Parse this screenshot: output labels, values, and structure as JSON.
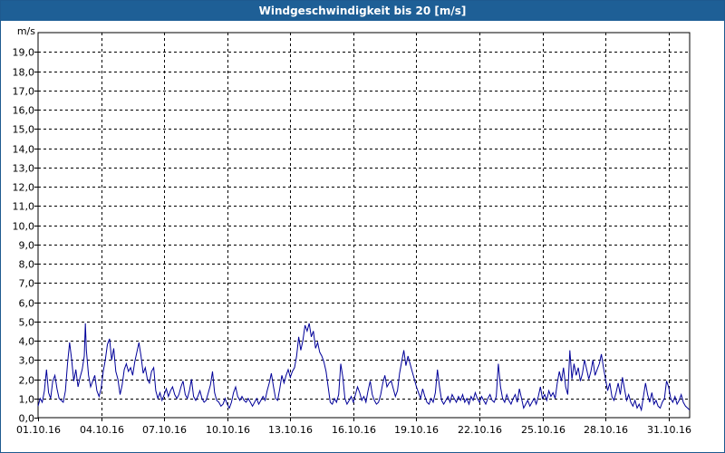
{
  "window": {
    "title": "Windgeschwindigkeit bis 20 [m/s]"
  },
  "colors": {
    "titlebar": "#1e5f96",
    "series": "#000099",
    "grid": "#000000"
  },
  "chart_data": {
    "type": "line",
    "title": "Windgeschwindigkeit bis 20 [m/s]",
    "ylabel": "m/s",
    "xlabel": "",
    "ylim": [
      0,
      20
    ],
    "xlim_days": [
      0,
      31
    ],
    "grid": true,
    "legend": "none",
    "y_ticks": [
      "0,0",
      "1,0",
      "2,0",
      "3,0",
      "4,0",
      "5,0",
      "6,0",
      "7,0",
      "8,0",
      "9,0",
      "10,0",
      "11,0",
      "12,0",
      "13,0",
      "14,0",
      "15,0",
      "16,0",
      "17,0",
      "18,0",
      "19,0"
    ],
    "x_ticks": [
      {
        "label": "01.10.16",
        "day": 0
      },
      {
        "label": "04.10.16",
        "day": 3
      },
      {
        "label": "07.10.16",
        "day": 6
      },
      {
        "label": "10.10.16",
        "day": 9
      },
      {
        "label": "13.10.16",
        "day": 12
      },
      {
        "label": "16.10.16",
        "day": 15
      },
      {
        "label": "19.10.16",
        "day": 18
      },
      {
        "label": "22.10.16",
        "day": 21
      },
      {
        "label": "25.10.16",
        "day": 24
      },
      {
        "label": "28.10.16",
        "day": 27
      },
      {
        "label": "31.10.16",
        "day": 30
      }
    ],
    "series": [
      {
        "values": [
          [
            0.0,
            0.6
          ],
          [
            0.1,
            1.0
          ],
          [
            0.2,
            0.8
          ],
          [
            0.3,
            1.4
          ],
          [
            0.4,
            2.5
          ],
          [
            0.5,
            1.3
          ],
          [
            0.6,
            1.0
          ],
          [
            0.7,
            1.9
          ],
          [
            0.8,
            2.2
          ],
          [
            0.9,
            1.5
          ],
          [
            1.0,
            1.0
          ],
          [
            1.1,
            0.9
          ],
          [
            1.2,
            0.8
          ],
          [
            1.3,
            1.4
          ],
          [
            1.4,
            2.8
          ],
          [
            1.5,
            3.9
          ],
          [
            1.6,
            3.0
          ],
          [
            1.7,
            1.9
          ],
          [
            1.8,
            2.5
          ],
          [
            1.9,
            1.6
          ],
          [
            2.0,
            2.1
          ],
          [
            2.1,
            2.5
          ],
          [
            2.2,
            3.2
          ],
          [
            2.25,
            4.9
          ],
          [
            2.3,
            3.5
          ],
          [
            2.4,
            2.2
          ],
          [
            2.5,
            1.6
          ],
          [
            2.6,
            1.9
          ],
          [
            2.7,
            2.2
          ],
          [
            2.8,
            1.4
          ],
          [
            2.9,
            1.1
          ],
          [
            3.0,
            1.5
          ],
          [
            3.1,
            2.4
          ],
          [
            3.2,
            3.0
          ],
          [
            3.3,
            3.8
          ],
          [
            3.4,
            4.1
          ],
          [
            3.5,
            3.0
          ],
          [
            3.6,
            3.6
          ],
          [
            3.7,
            2.4
          ],
          [
            3.8,
            2.0
          ],
          [
            3.9,
            1.2
          ],
          [
            4.0,
            1.7
          ],
          [
            4.1,
            2.5
          ],
          [
            4.2,
            2.8
          ],
          [
            4.3,
            2.4
          ],
          [
            4.4,
            2.6
          ],
          [
            4.5,
            2.2
          ],
          [
            4.6,
            2.9
          ],
          [
            4.7,
            3.4
          ],
          [
            4.8,
            3.9
          ],
          [
            4.9,
            3.2
          ],
          [
            5.0,
            2.3
          ],
          [
            5.1,
            2.6
          ],
          [
            5.2,
            2.0
          ],
          [
            5.3,
            1.8
          ],
          [
            5.4,
            2.4
          ],
          [
            5.5,
            2.6
          ],
          [
            5.6,
            1.4
          ],
          [
            5.7,
            1.0
          ],
          [
            5.8,
            1.3
          ],
          [
            5.9,
            0.9
          ],
          [
            6.0,
            1.2
          ],
          [
            6.1,
            1.5
          ],
          [
            6.2,
            1.1
          ],
          [
            6.3,
            1.4
          ],
          [
            6.4,
            1.6
          ],
          [
            6.5,
            1.2
          ],
          [
            6.6,
            1.0
          ],
          [
            6.7,
            1.2
          ],
          [
            6.8,
            1.6
          ],
          [
            6.9,
            1.9
          ],
          [
            7.0,
            1.2
          ],
          [
            7.1,
            1.0
          ],
          [
            7.2,
            1.4
          ],
          [
            7.3,
            2.0
          ],
          [
            7.4,
            1.1
          ],
          [
            7.5,
            0.9
          ],
          [
            7.6,
            1.1
          ],
          [
            7.7,
            1.4
          ],
          [
            7.8,
            1.0
          ],
          [
            7.9,
            0.8
          ],
          [
            8.0,
            0.9
          ],
          [
            8.1,
            1.3
          ],
          [
            8.2,
            1.7
          ],
          [
            8.3,
            2.4
          ],
          [
            8.4,
            1.3
          ],
          [
            8.5,
            0.9
          ],
          [
            8.6,
            0.8
          ],
          [
            8.7,
            0.6
          ],
          [
            8.8,
            0.7
          ],
          [
            8.9,
            1.0
          ],
          [
            9.0,
            0.7
          ],
          [
            9.1,
            0.5
          ],
          [
            9.2,
            0.8
          ],
          [
            9.3,
            1.3
          ],
          [
            9.4,
            1.6
          ],
          [
            9.5,
            1.1
          ],
          [
            9.6,
            0.9
          ],
          [
            9.7,
            1.1
          ],
          [
            9.8,
            0.9
          ],
          [
            9.9,
            0.8
          ],
          [
            10.0,
            1.0
          ],
          [
            10.1,
            0.8
          ],
          [
            10.2,
            0.6
          ],
          [
            10.3,
            0.8
          ],
          [
            10.4,
            1.0
          ],
          [
            10.5,
            0.7
          ],
          [
            10.6,
            0.9
          ],
          [
            10.7,
            1.1
          ],
          [
            10.8,
            0.9
          ],
          [
            10.9,
            1.4
          ],
          [
            11.0,
            1.8
          ],
          [
            11.1,
            2.3
          ],
          [
            11.2,
            1.6
          ],
          [
            11.3,
            1.0
          ],
          [
            11.4,
            0.9
          ],
          [
            11.5,
            1.5
          ],
          [
            11.6,
            2.2
          ],
          [
            11.7,
            1.8
          ],
          [
            11.8,
            2.2
          ],
          [
            11.9,
            2.5
          ],
          [
            12.0,
            2.1
          ],
          [
            12.1,
            2.4
          ],
          [
            12.2,
            2.6
          ],
          [
            12.3,
            3.2
          ],
          [
            12.4,
            4.2
          ],
          [
            12.5,
            3.5
          ],
          [
            12.6,
            4.0
          ],
          [
            12.7,
            4.8
          ],
          [
            12.8,
            4.5
          ],
          [
            12.9,
            4.9
          ],
          [
            13.0,
            4.2
          ],
          [
            13.1,
            4.5
          ],
          [
            13.2,
            3.6
          ],
          [
            13.3,
            3.9
          ],
          [
            13.4,
            3.4
          ],
          [
            13.5,
            3.2
          ],
          [
            13.6,
            2.9
          ],
          [
            13.7,
            2.4
          ],
          [
            13.8,
            1.6
          ],
          [
            13.9,
            0.8
          ],
          [
            14.0,
            0.7
          ],
          [
            14.1,
            1.0
          ],
          [
            14.2,
            0.8
          ],
          [
            14.3,
            1.2
          ],
          [
            14.4,
            2.8
          ],
          [
            14.5,
            2.1
          ],
          [
            14.6,
            1.0
          ],
          [
            14.7,
            0.7
          ],
          [
            14.8,
            0.9
          ],
          [
            14.9,
            1.1
          ],
          [
            15.0,
            0.8
          ],
          [
            15.1,
            1.2
          ],
          [
            15.2,
            1.6
          ],
          [
            15.3,
            1.3
          ],
          [
            15.4,
            0.9
          ],
          [
            15.5,
            1.1
          ],
          [
            15.6,
            0.8
          ],
          [
            15.7,
            1.4
          ],
          [
            15.8,
            1.9
          ],
          [
            15.9,
            1.2
          ],
          [
            16.0,
            0.9
          ],
          [
            16.1,
            0.7
          ],
          [
            16.2,
            0.8
          ],
          [
            16.3,
            1.2
          ],
          [
            16.4,
            1.8
          ],
          [
            16.5,
            2.2
          ],
          [
            16.6,
            1.6
          ],
          [
            16.7,
            1.8
          ],
          [
            16.8,
            1.9
          ],
          [
            16.9,
            1.5
          ],
          [
            17.0,
            1.1
          ],
          [
            17.1,
            1.4
          ],
          [
            17.2,
            2.3
          ],
          [
            17.3,
            2.9
          ],
          [
            17.4,
            3.5
          ],
          [
            17.5,
            2.7
          ],
          [
            17.6,
            3.2
          ],
          [
            17.7,
            2.8
          ],
          [
            17.8,
            2.4
          ],
          [
            17.9,
            2.0
          ],
          [
            18.0,
            1.6
          ],
          [
            18.1,
            1.3
          ],
          [
            18.2,
            1.0
          ],
          [
            18.3,
            1.5
          ],
          [
            18.4,
            1.1
          ],
          [
            18.5,
            0.8
          ],
          [
            18.6,
            0.7
          ],
          [
            18.7,
            1.0
          ],
          [
            18.8,
            0.8
          ],
          [
            18.9,
            1.3
          ],
          [
            19.0,
            2.5
          ],
          [
            19.1,
            1.6
          ],
          [
            19.2,
            0.9
          ],
          [
            19.3,
            0.7
          ],
          [
            19.4,
            0.9
          ],
          [
            19.5,
            1.1
          ],
          [
            19.6,
            0.8
          ],
          [
            19.7,
            1.2
          ],
          [
            19.8,
            1.0
          ],
          [
            19.9,
            0.8
          ],
          [
            20.0,
            1.1
          ],
          [
            20.1,
            0.9
          ],
          [
            20.2,
            1.2
          ],
          [
            20.3,
            0.8
          ],
          [
            20.4,
            1.0
          ],
          [
            20.5,
            0.7
          ],
          [
            20.6,
            1.1
          ],
          [
            20.7,
            0.9
          ],
          [
            20.8,
            1.3
          ],
          [
            20.9,
            1.0
          ],
          [
            21.0,
            0.8
          ],
          [
            21.1,
            1.1
          ],
          [
            21.2,
            0.9
          ],
          [
            21.3,
            0.7
          ],
          [
            21.4,
            1.0
          ],
          [
            21.5,
            1.2
          ],
          [
            21.6,
            0.9
          ],
          [
            21.7,
            0.8
          ],
          [
            21.8,
            1.1
          ],
          [
            21.9,
            2.8
          ],
          [
            22.0,
            1.6
          ],
          [
            22.1,
            1.0
          ],
          [
            22.2,
            0.8
          ],
          [
            22.3,
            1.2
          ],
          [
            22.4,
            0.9
          ],
          [
            22.5,
            0.7
          ],
          [
            22.6,
            1.0
          ],
          [
            22.7,
            1.2
          ],
          [
            22.8,
            0.8
          ],
          [
            22.9,
            1.5
          ],
          [
            23.0,
            1.0
          ],
          [
            23.1,
            0.5
          ],
          [
            23.2,
            0.7
          ],
          [
            23.3,
            0.9
          ],
          [
            23.4,
            0.6
          ],
          [
            23.5,
            0.8
          ],
          [
            23.6,
            1.0
          ],
          [
            23.7,
            0.7
          ],
          [
            23.8,
            1.1
          ],
          [
            23.9,
            1.6
          ],
          [
            24.0,
            1.0
          ],
          [
            24.1,
            1.2
          ],
          [
            24.2,
            0.9
          ],
          [
            24.3,
            1.4
          ],
          [
            24.4,
            1.1
          ],
          [
            24.5,
            1.3
          ],
          [
            24.6,
            1.0
          ],
          [
            24.7,
            1.8
          ],
          [
            24.8,
            2.4
          ],
          [
            24.9,
            1.9
          ],
          [
            25.0,
            2.6
          ],
          [
            25.1,
            1.6
          ],
          [
            25.2,
            1.2
          ],
          [
            25.3,
            3.5
          ],
          [
            25.4,
            2.0
          ],
          [
            25.5,
            2.8
          ],
          [
            25.6,
            2.2
          ],
          [
            25.7,
            2.6
          ],
          [
            25.8,
            1.9
          ],
          [
            25.9,
            2.3
          ],
          [
            26.0,
            3.0
          ],
          [
            26.1,
            2.5
          ],
          [
            26.2,
            2.0
          ],
          [
            26.3,
            2.4
          ],
          [
            26.4,
            3.0
          ],
          [
            26.5,
            2.2
          ],
          [
            26.6,
            2.5
          ],
          [
            26.7,
            2.8
          ],
          [
            26.8,
            3.3
          ],
          [
            26.9,
            2.6
          ],
          [
            27.0,
            2.0
          ],
          [
            27.1,
            1.4
          ],
          [
            27.2,
            1.8
          ],
          [
            27.3,
            1.1
          ],
          [
            27.4,
            0.9
          ],
          [
            27.5,
            1.3
          ],
          [
            27.6,
            1.8
          ],
          [
            27.7,
            1.2
          ],
          [
            27.8,
            2.1
          ],
          [
            27.9,
            1.5
          ],
          [
            28.0,
            0.9
          ],
          [
            28.1,
            1.2
          ],
          [
            28.2,
            0.8
          ],
          [
            28.3,
            0.6
          ],
          [
            28.4,
            0.9
          ],
          [
            28.5,
            0.5
          ],
          [
            28.6,
            0.7
          ],
          [
            28.7,
            0.4
          ],
          [
            28.8,
            1.1
          ],
          [
            28.9,
            1.8
          ],
          [
            29.0,
            1.2
          ],
          [
            29.1,
            0.8
          ],
          [
            29.2,
            1.3
          ],
          [
            29.3,
            0.7
          ],
          [
            29.4,
            0.9
          ],
          [
            29.5,
            0.6
          ],
          [
            29.6,
            0.5
          ],
          [
            29.7,
            0.8
          ],
          [
            29.8,
            1.0
          ],
          [
            29.9,
            1.9
          ],
          [
            30.0,
            1.6
          ],
          [
            30.1,
            1.0
          ],
          [
            30.2,
            0.8
          ],
          [
            30.3,
            1.1
          ],
          [
            30.4,
            0.7
          ],
          [
            30.5,
            0.9
          ],
          [
            30.6,
            1.2
          ],
          [
            30.7,
            0.8
          ],
          [
            30.8,
            0.6
          ],
          [
            30.9,
            0.5
          ],
          [
            31.0,
            0.4
          ]
        ]
      }
    ]
  }
}
